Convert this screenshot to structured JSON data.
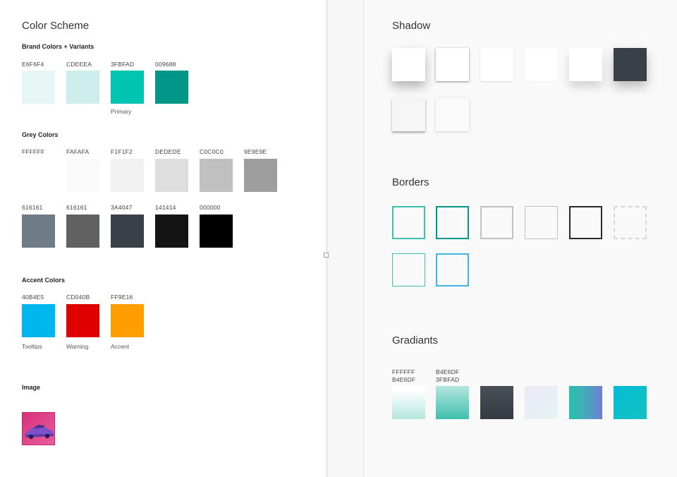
{
  "left": {
    "title": "Color Scheme",
    "brand": {
      "heading": "Brand Colors + Variants",
      "swatches": [
        {
          "hex": "E6F6F4",
          "color": "#e6f6f4",
          "caption": ""
        },
        {
          "hex": "CDEEEA",
          "color": "#cdeeea",
          "caption": ""
        },
        {
          "hex": "3FBFAD",
          "color": "#00c4b0",
          "caption": "Primary"
        },
        {
          "hex": "009688",
          "color": "#009688",
          "caption": ""
        }
      ]
    },
    "grey": {
      "heading": "Grey Colors",
      "row1": [
        {
          "hex": "FFFFFF",
          "color": "#ffffff"
        },
        {
          "hex": "FAFAFA",
          "color": "#fafafa"
        },
        {
          "hex": "F1F1F2",
          "color": "#f1f1f2"
        },
        {
          "hex": "DEDEDE",
          "color": "#dedede"
        },
        {
          "hex": "C0C0C0",
          "color": "#c0c0c0"
        },
        {
          "hex": "9E9E9E",
          "color": "#9e9e9e"
        }
      ],
      "row2": [
        {
          "hex": "616161",
          "color": "#6f7b86"
        },
        {
          "hex": "616161",
          "color": "#616161"
        },
        {
          "hex": "3A4047",
          "color": "#3a4047"
        },
        {
          "hex": "141414",
          "color": "#141414"
        },
        {
          "hex": "000000",
          "color": "#000000"
        }
      ]
    },
    "accent": {
      "heading": "Accent Colors",
      "swatches": [
        {
          "hex": "40B4E5",
          "color": "#00b6ef",
          "caption": "Tooltips"
        },
        {
          "hex": "CD040B",
          "color": "#e00000",
          "caption": "Warning"
        },
        {
          "hex": "FF9E16",
          "color": "#ff9e00",
          "caption": "Accent"
        }
      ]
    },
    "image": {
      "heading": "Image"
    }
  },
  "right": {
    "shadow": {
      "title": "Shadow"
    },
    "borders": {
      "title": "Borders"
    },
    "gradients": {
      "title": "Gradiants",
      "labels": [
        {
          "line1": "FFFFFF",
          "line2": "B4E6DF"
        },
        {
          "line1": "B4E6DF",
          "line2": "3FBFAD"
        }
      ]
    }
  }
}
